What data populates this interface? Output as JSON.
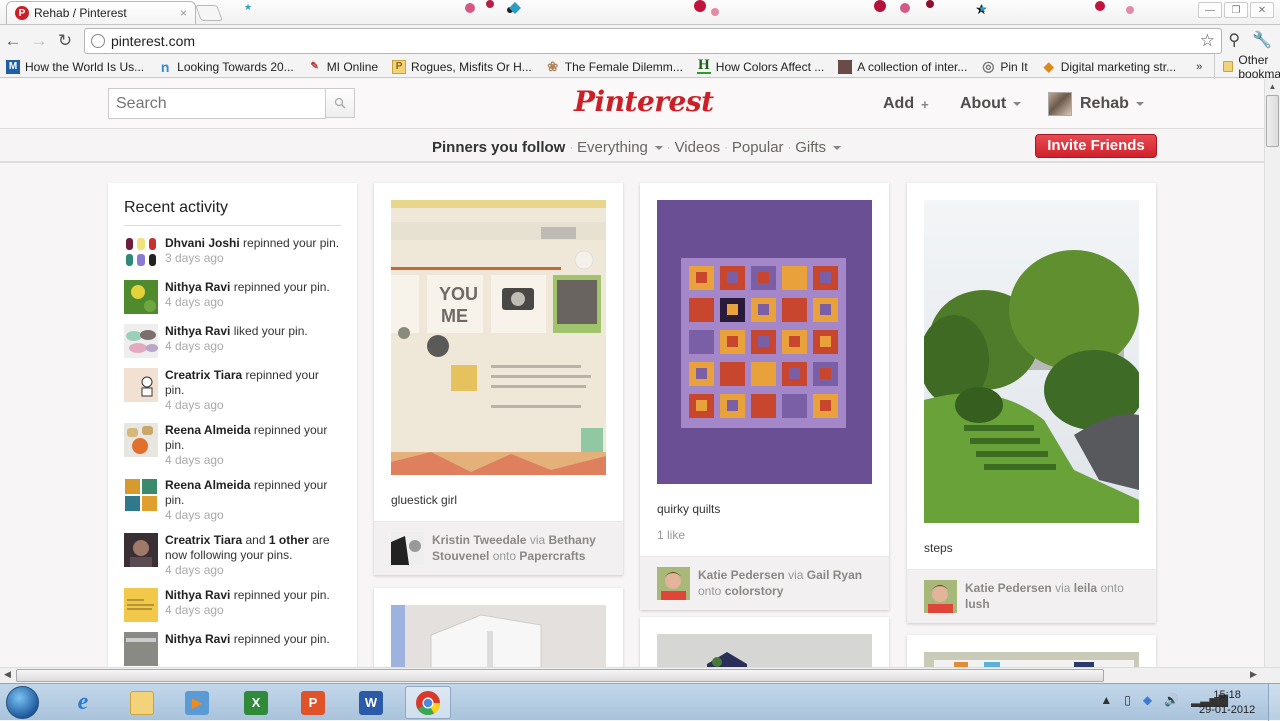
{
  "browser": {
    "tab_title": "Rehab / Pinterest",
    "tab_close": "×",
    "url": "pinterest.com",
    "back": "←",
    "forward": "→",
    "reload": "↻",
    "star": "☆",
    "bookmarks": [
      {
        "icon": "M",
        "label": "How the World Is Us...",
        "color": "#1f5fa6"
      },
      {
        "icon": "n",
        "label": "Looking Towards 20...",
        "color": "#3a8ad6"
      },
      {
        "icon": "✎",
        "label": "MI Online",
        "color": "#c0392b"
      },
      {
        "icon": "P",
        "label": "Rogues, Misfits Or H...",
        "color": "#e2b33a"
      },
      {
        "icon": "❀",
        "label": "The Female Dilemm...",
        "color": "#b0835c"
      },
      {
        "icon": "H",
        "label": "How Colors Affect ...",
        "color": "#1a5e1a"
      },
      {
        "icon": "▪",
        "label": "A collection of inter...",
        "color": "#6b4a4a"
      },
      {
        "icon": "◎",
        "label": "Pin It",
        "color": "#777777"
      },
      {
        "icon": "◆",
        "label": "Digital marketing str...",
        "color": "#d98a1f"
      }
    ],
    "bookmarks_more": "»",
    "other_bookmarks": "Other bookmarks"
  },
  "header": {
    "search_placeholder": "Search",
    "logo": "Pinterest",
    "add_label": "Add",
    "add_plus": "+",
    "about_label": "About",
    "user_name": "Rehab"
  },
  "subnav": {
    "links": [
      "Pinners you follow",
      "Everything",
      "Videos",
      "Popular",
      "Gifts"
    ],
    "separator": "·",
    "invite_label": "Invite Friends"
  },
  "activity": {
    "title": "Recent activity",
    "items": [
      {
        "user": "Dhvani Joshi",
        "action": " repinned your pin.",
        "time": "3 days ago"
      },
      {
        "user": "Nithya Ravi",
        "action": " repinned your pin.",
        "time": "4 days ago"
      },
      {
        "user": "Nithya Ravi",
        "action": " liked your pin.",
        "time": "4 days ago"
      },
      {
        "user": "Creatrix Tiara",
        "action": " repinned your pin.",
        "time": "4 days ago"
      },
      {
        "user": "Reena Almeida",
        "action": " repinned your pin.",
        "time": "4 days ago"
      },
      {
        "user": "Reena Almeida",
        "action": " repinned your pin.",
        "time": "4 days ago"
      },
      {
        "user": "Creatrix Tiara",
        "action": " and ",
        "extra_bold": "1 other",
        "action2": " are now following your pins.",
        "time": "4 days ago"
      },
      {
        "user": "Nithya Ravi",
        "action": " repinned your pin.",
        "time": "4 days ago"
      },
      {
        "user": "Nithya Ravi",
        "action": " repinned your pin.",
        "time": ""
      }
    ]
  },
  "pins": [
    {
      "description": "gluestick girl",
      "pinner": "Kristin Tweedale",
      "via_word": "via",
      "via": "Bethany Stouvenel",
      "onto_word": "onto",
      "board": "Papercrafts"
    },
    {
      "description": "quirky quilts",
      "likes": "1 like",
      "pinner": "Katie Pedersen",
      "via_word": "via",
      "via": "Gail Ryan",
      "onto_word": "onto",
      "board": "colorstory"
    },
    {
      "description": "steps",
      "pinner": "Katie Pedersen",
      "via_word": "via",
      "via": "leila",
      "onto_word": "onto",
      "board": "lush"
    }
  ],
  "taskbar": {
    "apps": [
      "Internet Explorer",
      "Windows Explorer",
      "Windows Media Player",
      "Excel",
      "PowerPoint",
      "Word",
      "Chrome"
    ],
    "time": "15:18",
    "date": "29-01-2012"
  },
  "colors": {
    "brand_red": "#cb2027",
    "invite_red": "#d9303a"
  }
}
